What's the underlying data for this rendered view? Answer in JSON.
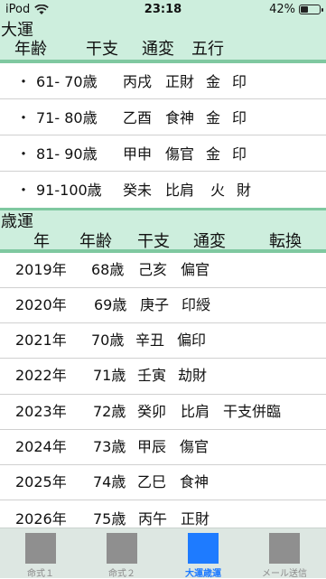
{
  "status_bar": {
    "carrier": "iPod",
    "time": "23:18",
    "battery": "42%",
    "battery_level": 0.42
  },
  "taiun": {
    "title": "大運",
    "headers": [
      "年齢",
      "干支",
      "通変",
      "五行"
    ],
    "rows": [
      {
        "bullet": "・",
        "age": "61- 70歳",
        "kanshi": "丙戌",
        "tsuhen": "正財",
        "gogyo1": "金",
        "gogyo2": "印"
      },
      {
        "bullet": "・",
        "age": "71- 80歳",
        "kanshi": "乙酉",
        "tsuhen": "食神",
        "gogyo1": "金",
        "gogyo2": "印"
      },
      {
        "bullet": "・",
        "age": "81- 90歳",
        "kanshi": "甲申",
        "tsuhen": "傷官",
        "gogyo1": "金",
        "gogyo2": "印"
      },
      {
        "bullet": "・",
        "age": "91-100歳",
        "kanshi": "癸未",
        "tsuhen": "比肩",
        "gogyo1": "火",
        "gogyo2": "財"
      }
    ]
  },
  "saiun": {
    "title": "歳運",
    "headers": [
      "年",
      "年齢",
      "干支",
      "通変",
      "転換"
    ],
    "rows": [
      {
        "year": "2019年",
        "age": "68歳",
        "kanshi": "己亥",
        "tsuhen": "偏官",
        "tenkan": ""
      },
      {
        "year": "2020年",
        "age": "69歳",
        "kanshi": "庚子",
        "tsuhen": "印綬",
        "tenkan": ""
      },
      {
        "year": "2021年",
        "age": "70歳",
        "kanshi": "辛丑",
        "tsuhen": "偏印",
        "tenkan": ""
      },
      {
        "year": "2022年",
        "age": "71歳",
        "kanshi": "壬寅",
        "tsuhen": "劫財",
        "tenkan": ""
      },
      {
        "year": "2023年",
        "age": "72歳",
        "kanshi": "癸卯",
        "tsuhen": "比肩",
        "tenkan": "干支併臨"
      },
      {
        "year": "2024年",
        "age": "73歳",
        "kanshi": "甲辰",
        "tsuhen": "傷官",
        "tenkan": ""
      },
      {
        "year": "2025年",
        "age": "74歳",
        "kanshi": "乙巳",
        "tsuhen": "食神",
        "tenkan": ""
      },
      {
        "year": "2026年",
        "age": "75歳",
        "kanshi": "丙午",
        "tsuhen": "正財",
        "tenkan": ""
      }
    ]
  },
  "tabs": [
    {
      "label": "命式１",
      "icon": "placeholder-square-icon",
      "active": false
    },
    {
      "label": "命式２",
      "icon": "placeholder-square-icon",
      "active": false
    },
    {
      "label": "大運歳運",
      "icon": "placeholder-square-icon",
      "active": true
    },
    {
      "label": "メール送信",
      "icon": "placeholder-square-icon",
      "active": false
    }
  ],
  "colors": {
    "header_bg": "#cdeedd",
    "header_border": "#7fc8a0",
    "tab_active": "#1e7bff",
    "tab_inactive": "#8f8f8f"
  }
}
